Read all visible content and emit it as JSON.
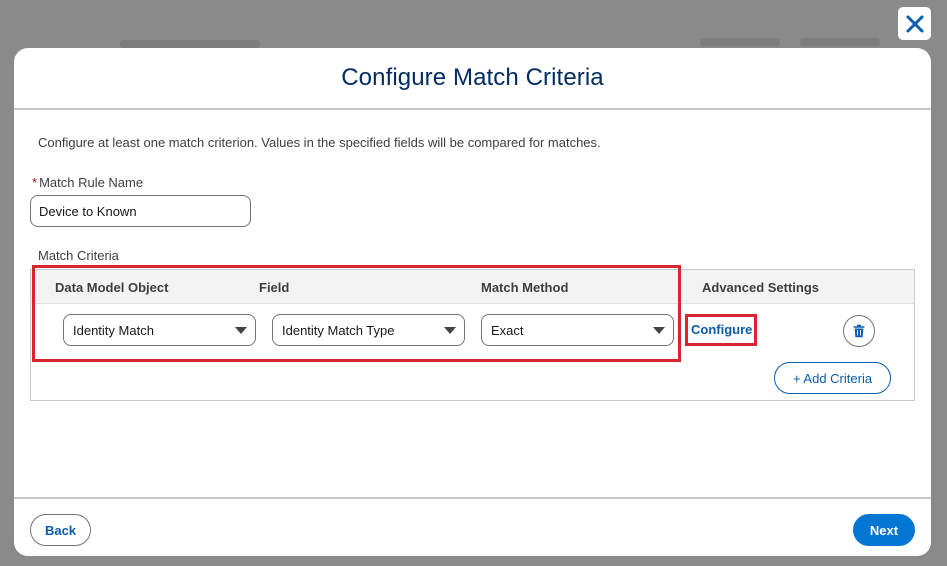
{
  "modal": {
    "title": "Configure Match Criteria",
    "intro": "Configure at least one match criterion. Values in the specified fields will be compared for matches."
  },
  "rule_name": {
    "required_mark": "*",
    "label": "Match Rule Name",
    "value": "Device to Known"
  },
  "criteria": {
    "section_label": "Match Criteria",
    "columns": [
      "Data Model Object",
      "Field",
      "Match Method",
      "Advanced Settings"
    ],
    "rows": [
      {
        "data_model_object": "Identity Match",
        "field": "Identity Match Type",
        "match_method": "Exact",
        "advanced_settings_link": "Configure"
      }
    ],
    "add_button": "+ Add Criteria"
  },
  "footer": {
    "back_label": "Back",
    "next_label": "Next"
  },
  "icons": {
    "close": "close-icon",
    "delete": "trash-icon",
    "caret": "chevron-down-icon"
  },
  "colors": {
    "brand": "#0176d3",
    "link": "#0b5cab",
    "title": "#032d60",
    "highlight": "#d9262e"
  }
}
